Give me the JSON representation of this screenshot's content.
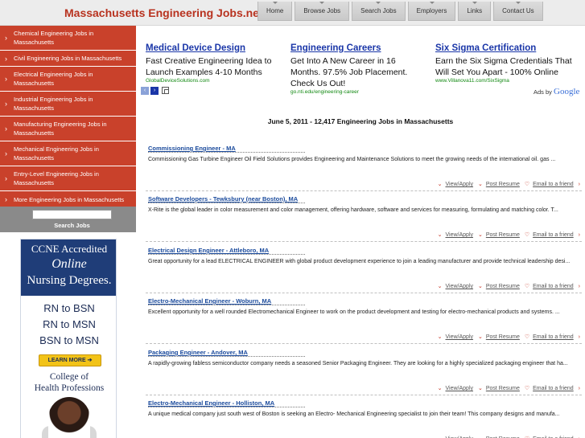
{
  "header": {
    "site_title": "Massachusetts Engineering Jobs.net",
    "nav": [
      "Home",
      "Browse Jobs",
      "Search Jobs",
      "Employers",
      "Links",
      "Contact Us"
    ]
  },
  "sidebar": {
    "items": [
      "Chemical Engineering Jobs in Massachusetts",
      "Civil Engineering Jobs in Massachusetts",
      "Electrical Engineering Jobs in Massachusetts",
      "Industrial Engineering Jobs in Massachusetts",
      "Manufacturing Engineering Jobs in Massachusetts",
      "Mechanical Engineering Jobs in Massachusetts",
      "Entry-Level Engineering Jobs in Massachusetts",
      "More Engineering Jobs in Massachusetts"
    ],
    "search_value": "",
    "search_button": "Search Jobs",
    "chevron": "›"
  },
  "side_ad": {
    "line1": "CCNE Accredited",
    "line2": "Online",
    "line3": "Nursing Degrees.",
    "degrees": [
      "RN to BSN",
      "RN to MSN",
      "BSN to MSN"
    ],
    "cta": "LEARN MORE ➔",
    "college_line1": "College of",
    "college_line2": "Health Professions"
  },
  "ads": [
    {
      "title": "Medical Device Design",
      "text": "Fast Creative Engineering Idea to Launch Examples 4-10 Months",
      "url": "GlobalDeviceSolutions.com"
    },
    {
      "title": "Engineering Careers",
      "text": "Get Into A New Career in 16 Months. 97.5% Job Placement. Check Us Out!",
      "url": "go.nti.edu/engineering-career"
    },
    {
      "title": "Six Sigma Certification",
      "text": "Earn the Six Sigma Credentials That Will Set You Apart - 100% Online",
      "url": "www.Villanova11.com/SixSigma"
    }
  ],
  "ads_nav": {
    "prev": "‹",
    "next": "›"
  },
  "ads_by": {
    "label": "Ads by",
    "brand": "Google"
  },
  "headline": "June 5, 2011 - 12,417 Engineering Jobs in Massachusetts",
  "actions": {
    "view": "View/Apply",
    "save": "Post Resume",
    "email": "Email to a friend",
    "arrow": "›",
    "bullet": "⌄",
    "heart": "♡"
  },
  "jobs": [
    {
      "title": "Commissioning Engineer - MA",
      "desc": "Commissioning Gas Turbine Engineer Oil Field Solutions provides Engineering and Maintenance Solutions to meet the growing needs of the international oil. gas ..."
    },
    {
      "title": "Software Developers - Tewksbury (near Boston), MA",
      "desc": "X-Rite is the global leader in color measurement and color management, offering hardware, software and services for measuring, formulating and matching color. T..."
    },
    {
      "title": "Electrical Design Engineer - Attleboro, MA",
      "desc": "Great opportunity for a lead ELECTRICAL ENGINEER with global product development experience to join a leading manufacturer and provide technical leadership desi..."
    },
    {
      "title": "Electro-Mechanical Engineer - Woburn, MA",
      "desc": "Excellent opportunity for a well rounded Electromechanical Engineer to work on the product development and testing for electro-mechanical products and systems. ..."
    },
    {
      "title": "Packaging Engineer - Andover, MA",
      "desc": "A rapidly-growing fabless semiconductor company needs a seasoned Senior Packaging Engineer. They are looking for a highly specialized packaging engineer that ha..."
    },
    {
      "title": "Electro-Mechanical Engineer - Holliston, MA",
      "desc": "A unique medical company just south west of Boston is seeking an Electro- Mechanical Engineering specialist to join their team! This company designs and manufa..."
    }
  ]
}
